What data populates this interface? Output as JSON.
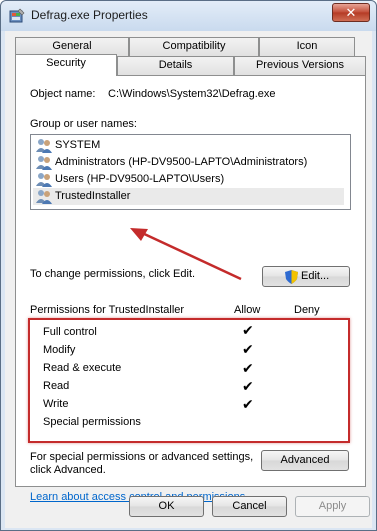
{
  "window": {
    "title": "Defrag.exe Properties",
    "close_glyph": "✕"
  },
  "tabs": {
    "row1": [
      "General",
      "Compatibility",
      "Icon"
    ],
    "row2": [
      "Security",
      "Details",
      "Previous Versions"
    ],
    "active": "Security"
  },
  "security": {
    "object_name_label": "Object name:",
    "object_name_value": "C:\\Windows\\System32\\Defrag.exe",
    "group_label": "Group or user names:",
    "users": [
      {
        "name": "SYSTEM",
        "icon": "user-group-icon"
      },
      {
        "name": "Administrators (HP-DV9500-LAPTO\\Administrators)",
        "icon": "user-group-icon"
      },
      {
        "name": "Users (HP-DV9500-LAPTO\\Users)",
        "icon": "user-group-icon"
      },
      {
        "name": "TrustedInstaller",
        "icon": "user-group-icon",
        "selected": true
      }
    ],
    "change_text": "To change permissions, click Edit.",
    "edit_label": "Edit...",
    "perm_header": "Permissions for TrustedInstaller",
    "allow_header": "Allow",
    "deny_header": "Deny",
    "permissions": [
      {
        "name": "Full control",
        "allow": true,
        "deny": false
      },
      {
        "name": "Modify",
        "allow": true,
        "deny": false
      },
      {
        "name": "Read & execute",
        "allow": true,
        "deny": false
      },
      {
        "name": "Read",
        "allow": true,
        "deny": false
      },
      {
        "name": "Write",
        "allow": true,
        "deny": false
      },
      {
        "name": "Special permissions",
        "allow": false,
        "deny": false
      }
    ],
    "check_glyph": "✔",
    "special_text_1": "For special permissions or advanced settings,",
    "special_text_2": "click Advanced.",
    "advanced_label": "Advanced",
    "learn_link": "Learn about access control and permissions"
  },
  "footer": {
    "ok": "OK",
    "cancel": "Cancel",
    "apply": "Apply"
  },
  "colors": {
    "annotation_red": "#c42b2b",
    "link": "#0066cc"
  }
}
